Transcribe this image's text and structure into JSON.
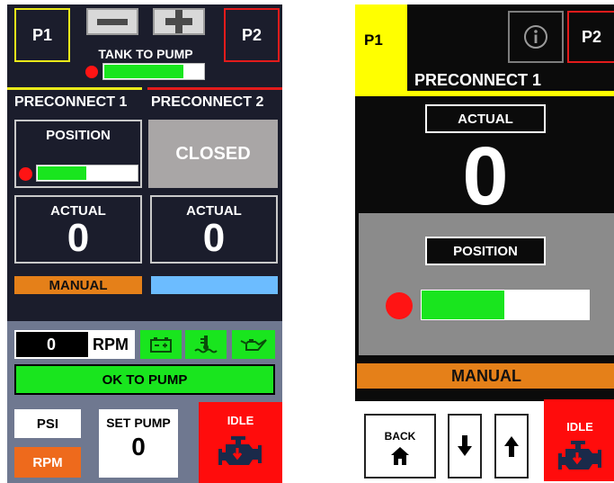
{
  "left": {
    "p1": "P1",
    "p2": "P2",
    "tank_to_pump": "TANK TO PUMP",
    "tank_progress": 0.8,
    "preconnect1": "PRECONNECT 1",
    "preconnect2": "PRECONNECT 2",
    "position_label": "POSITION",
    "position_progress": 0.5,
    "closed_label": "CLOSED",
    "actual1_label": "ACTUAL",
    "actual1_value": "0",
    "actual2_label": "ACTUAL",
    "actual2_value": "0",
    "manual_label": "MANUAL",
    "rpm_value": "0",
    "rpm_label": "RPM",
    "ok_to_pump": "OK TO PUMP",
    "psi": "PSI",
    "rpm_button": "RPM",
    "set_pump_label": "SET PUMP",
    "set_pump_value": "0",
    "idle": "IDLE"
  },
  "right": {
    "p1": "P1",
    "p2": "P2",
    "title": "PRECONNECT 1",
    "actual_label": "ACTUAL",
    "actual_value": "0",
    "position_label": "POSITION",
    "position_progress": 0.5,
    "manual_label": "MANUAL",
    "back": "BACK",
    "idle": "IDLE"
  },
  "colors": {
    "panel_bg": "#1b1d2c",
    "green": "#19e51e",
    "orange": "#e58019",
    "blue": "#6cbcff",
    "red": "#ff1414",
    "yellow": "#ffff00"
  },
  "icons": [
    "minus-icon",
    "plus-icon",
    "battery-icon",
    "coolant-icon",
    "oil-can-icon",
    "engine-icon",
    "info-icon",
    "home-icon",
    "arrow-down-icon",
    "arrow-up-icon"
  ]
}
